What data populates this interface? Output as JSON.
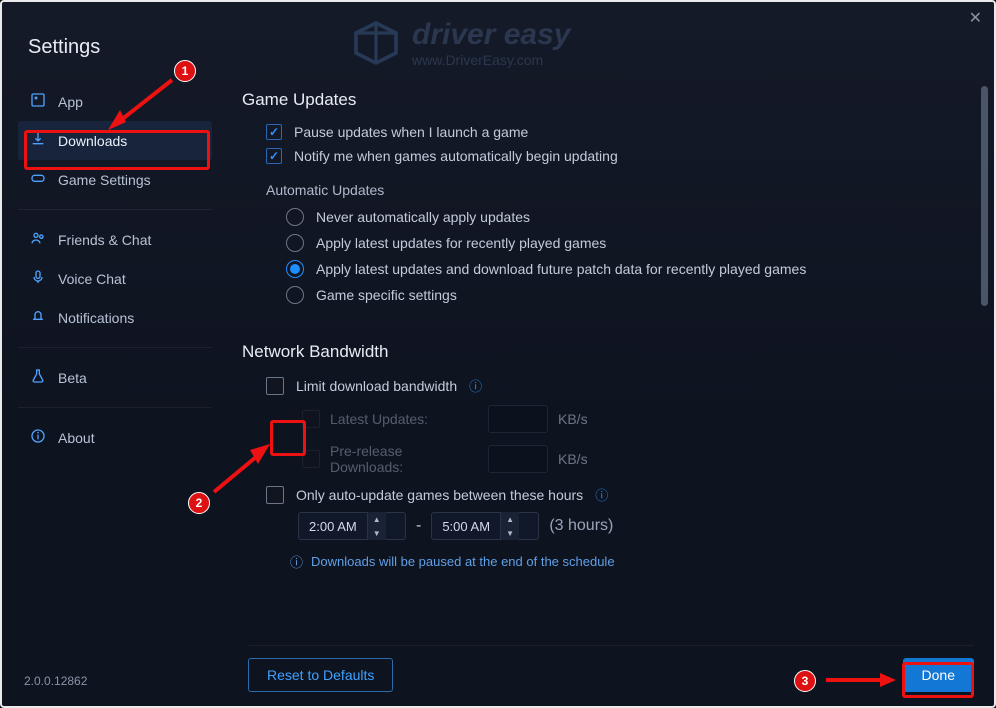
{
  "window_title": "Settings",
  "watermark": {
    "brand": "driver easy",
    "url": "www.DriverEasy.com"
  },
  "sidebar": {
    "groups": [
      [
        {
          "id": "app",
          "label": "App",
          "icon": "app-icon"
        },
        {
          "id": "downloads",
          "label": "Downloads",
          "icon": "download-icon",
          "active": true
        },
        {
          "id": "game",
          "label": "Game Settings",
          "icon": "gamepad-icon"
        }
      ],
      [
        {
          "id": "friends",
          "label": "Friends & Chat",
          "icon": "friends-icon"
        },
        {
          "id": "voice",
          "label": "Voice Chat",
          "icon": "mic-icon"
        },
        {
          "id": "notif",
          "label": "Notifications",
          "icon": "bell-icon"
        }
      ],
      [
        {
          "id": "beta",
          "label": "Beta",
          "icon": "flask-icon"
        }
      ],
      [
        {
          "id": "about",
          "label": "About",
          "icon": "info-icon"
        }
      ]
    ]
  },
  "game_updates": {
    "heading": "Game Updates",
    "pause_label": "Pause updates when I launch a game",
    "pause_checked": true,
    "notify_label": "Notify me when games automatically begin updating",
    "notify_checked": true,
    "auto_heading": "Automatic Updates",
    "radio_options": [
      "Never automatically apply updates",
      "Apply latest updates for recently played games",
      "Apply latest updates and download future patch data for recently played games",
      "Game specific settings"
    ],
    "radio_selected": 2
  },
  "bandwidth": {
    "heading": "Network Bandwidth",
    "limit_label": "Limit download bandwidth",
    "limit_checked": false,
    "latest_label": "Latest Updates:",
    "prerelease_label": "Pre-release Downloads:",
    "unit": "KB/s",
    "hours_label": "Only auto-update games between these hours",
    "hours_checked": false,
    "time_from": "2:00 AM",
    "time_to": "5:00 AM",
    "hours_duration": "(3 hours)",
    "note": "Downloads will be paused at the end of the schedule"
  },
  "footer": {
    "reset_label": "Reset to Defaults",
    "done_label": "Done"
  },
  "version": "2.0.0.12862",
  "annotations": {
    "step1": "1",
    "step2": "2",
    "step3": "3"
  }
}
